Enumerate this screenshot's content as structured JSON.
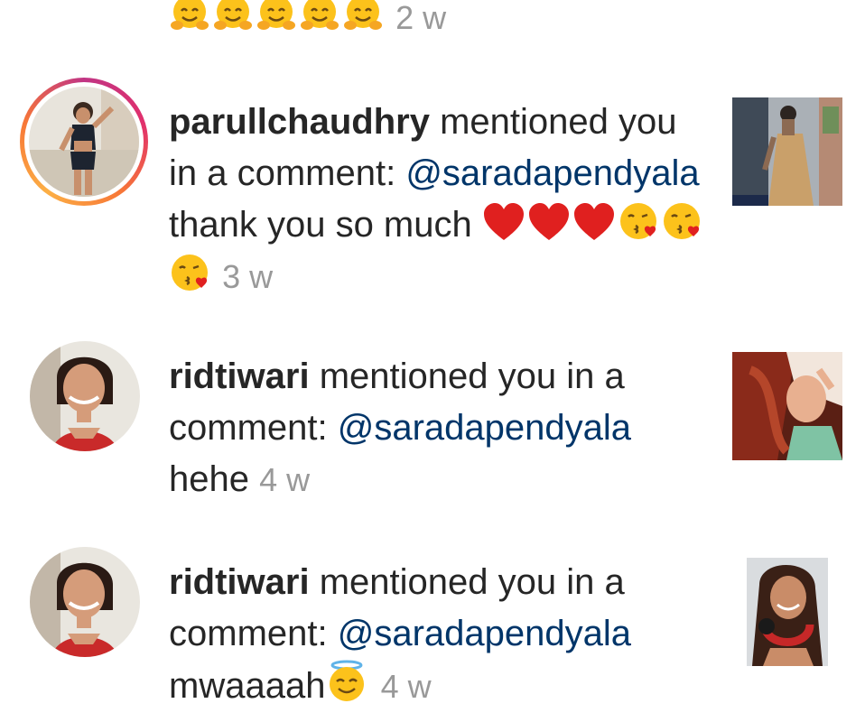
{
  "feed": {
    "top_partial": {
      "emoji_icon": "hugging-face-icon",
      "emoji_count": 5,
      "time": "2 w"
    },
    "items": [
      {
        "username": "parullchaudhry",
        "action": " mentioned you in a comment: ",
        "mention": "@saradapendyala",
        "message": " thank you so much ",
        "emoji_icons": [
          "red-heart-icon",
          "red-heart-icon",
          "red-heart-icon",
          "kissing-face-icon",
          "kissing-face-icon",
          "kissing-face-icon"
        ],
        "time": "3 w",
        "has_story_ring": true
      },
      {
        "username": "ridtiwari",
        "action": " mentioned you in a comment: ",
        "mention": "@saradapendyala",
        "message": " hehe ",
        "emoji_icons": [],
        "time": "4 w",
        "has_story_ring": false
      },
      {
        "username": "ridtiwari",
        "action": " mentioned you in a comment: ",
        "mention": "@saradapendyala",
        "message": " mwaaaah",
        "emoji_icons": [
          "smiling-face-with-halo-icon"
        ],
        "time": "4 w",
        "has_story_ring": false
      }
    ]
  },
  "colors": {
    "text": "#262626",
    "mention": "#003569",
    "timestamp": "#999999",
    "story_ring": "#e1306c"
  }
}
